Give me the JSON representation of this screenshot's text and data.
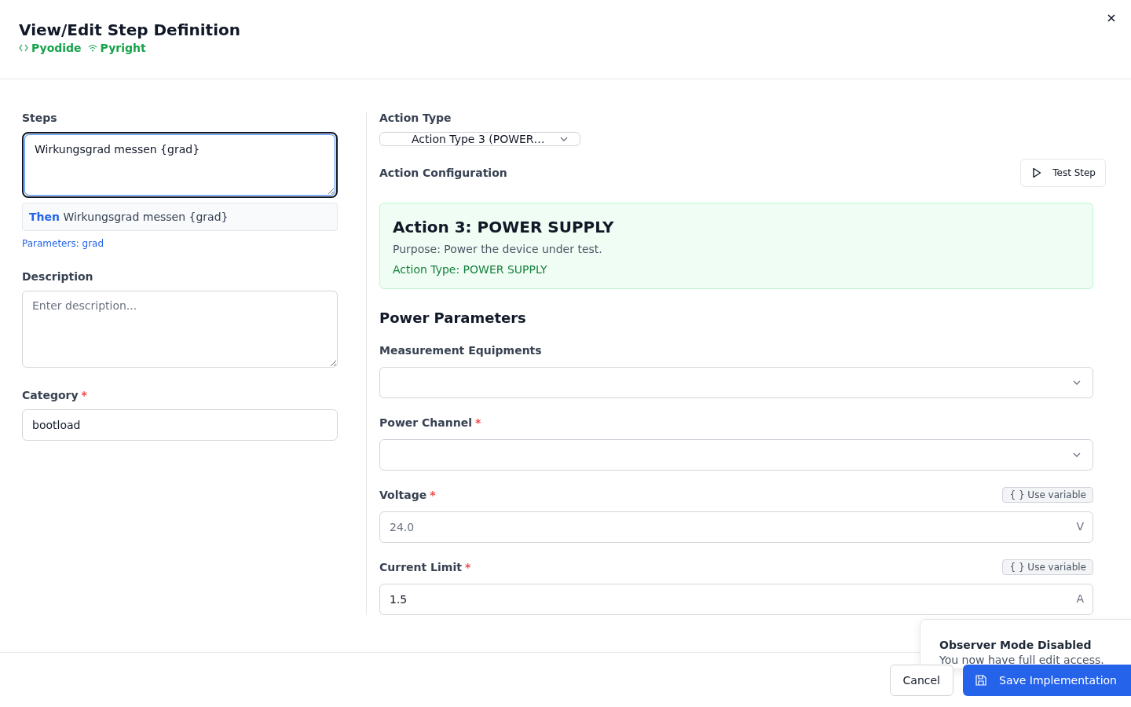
{
  "dialog": {
    "title": "View/Edit Step Definition",
    "badges": [
      {
        "kind": "code",
        "label": "Pyodide"
      },
      {
        "kind": "signal",
        "label": "Pyright"
      }
    ]
  },
  "steps": {
    "label": "Steps",
    "value": "Wirkungsgrad messen {grad}",
    "preview_keyword": "Then",
    "preview_text": "Wirkungsgrad messen {grad}",
    "parameters": "Parameters: grad"
  },
  "description": {
    "label": "Description",
    "placeholder": "Enter description..."
  },
  "category": {
    "label": "Category",
    "required_mark": "*",
    "value": "bootload"
  },
  "action_type": {
    "label": "Action Type",
    "value": "Action Type 3 (POWER…"
  },
  "action_configuration": {
    "label": "Action Configuration",
    "test_button": "Test Step"
  },
  "action_card": {
    "title": "Action 3: POWER SUPPLY",
    "purpose": "Purpose: Power the device under test.",
    "type": "Action Type: POWER SUPPLY"
  },
  "power_parameters": {
    "heading": "Power Parameters",
    "fields": [
      {
        "kind": "select",
        "label": "Measurement Equipments"
      },
      {
        "kind": "select",
        "label": "Power Channel",
        "required_mark": "*"
      },
      {
        "kind": "number",
        "label": "Voltage",
        "required_mark": "*",
        "variable_button": "{ } Use variable",
        "placeholder": "24.0",
        "unit": "V"
      },
      {
        "kind": "number",
        "label": "Current Limit",
        "required_mark": "*",
        "variable_button": "{ } Use variable",
        "value": "1.5",
        "unit": "A"
      }
    ]
  },
  "footer": {
    "buttons": [
      {
        "kind": "secondary",
        "label": "Cancel"
      },
      {
        "kind": "primary",
        "label": "Save Implementation"
      }
    ]
  },
  "toast": {
    "title": "Observer Mode Disabled",
    "message": "You now have full edit access."
  }
}
